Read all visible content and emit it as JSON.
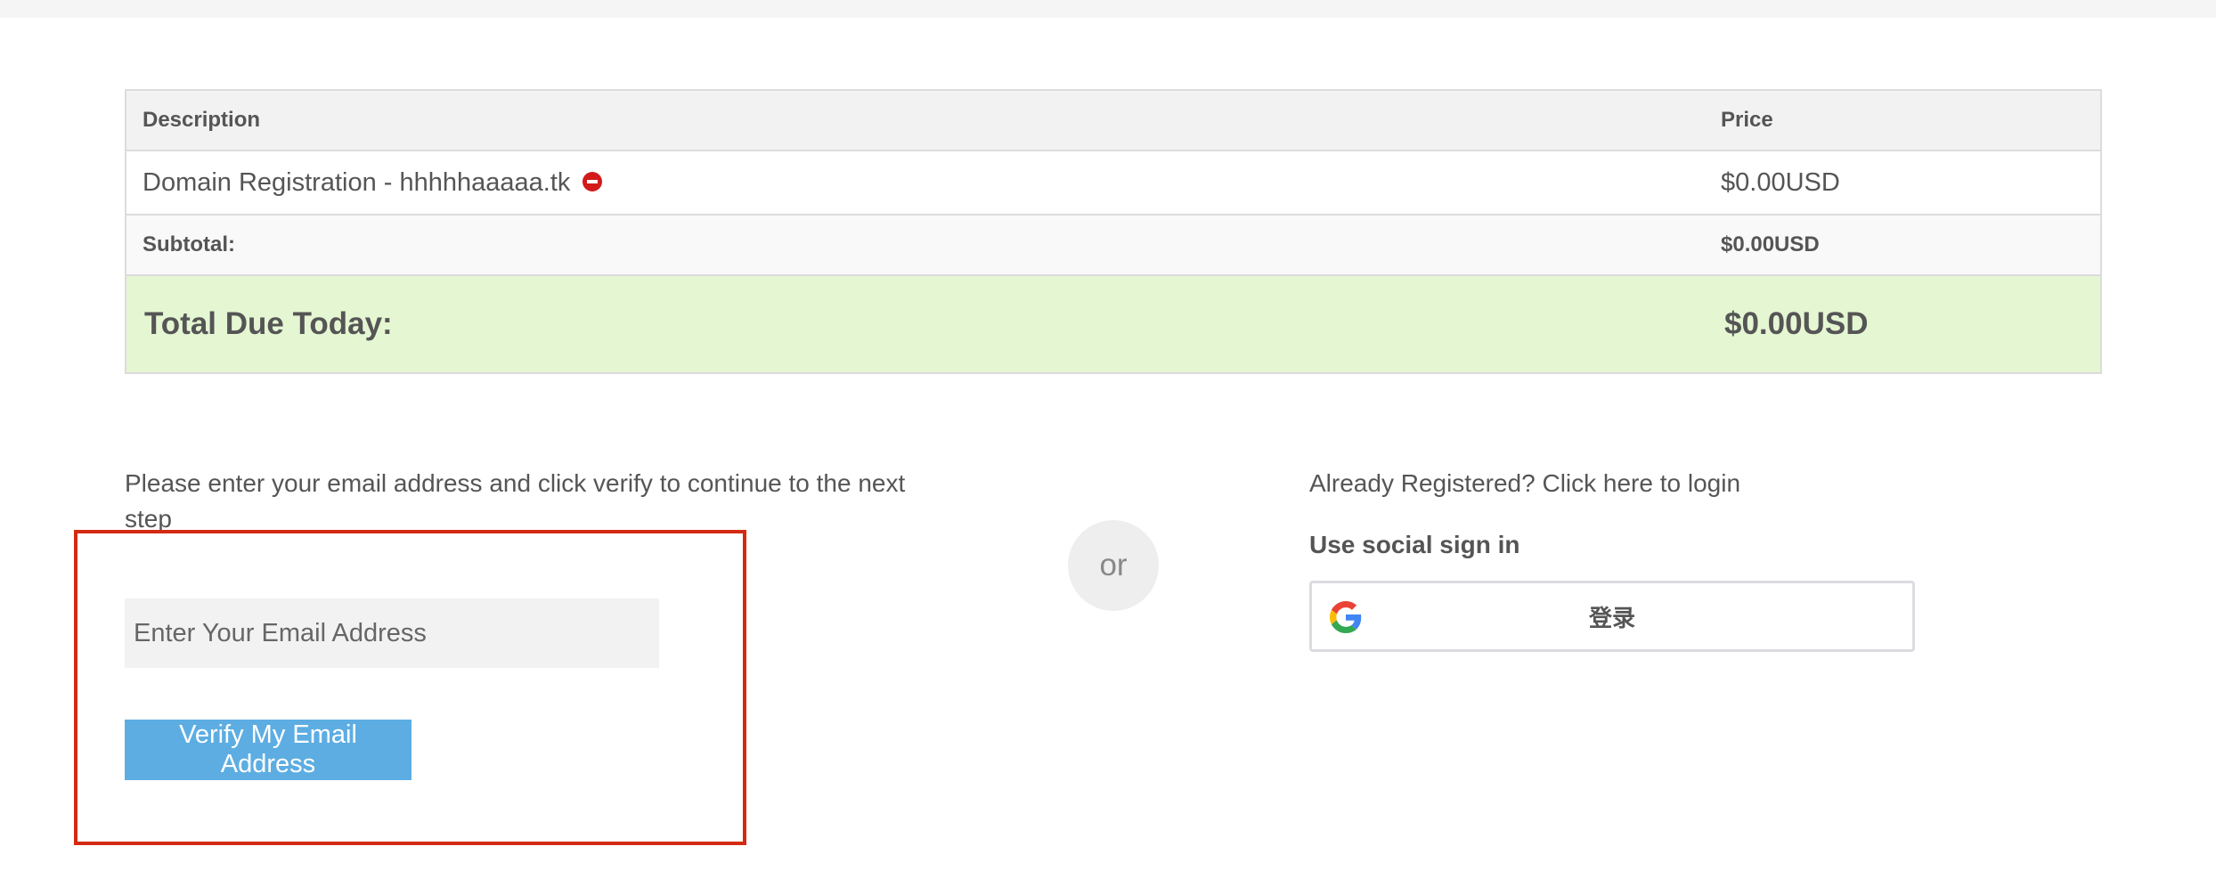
{
  "cart": {
    "headers": {
      "description": "Description",
      "price": "Price"
    },
    "item": {
      "description": "Domain Registration - hhhhhaaaaa.tk",
      "price": "$0.00USD",
      "remove_icon": "remove-circle-icon"
    },
    "subtotal": {
      "label": "Subtotal:",
      "value": "$0.00USD"
    },
    "total": {
      "label": "Total Due Today:",
      "value": "$0.00USD"
    }
  },
  "email_verify": {
    "instructions": "Please enter your email address and click verify to continue to the next step",
    "input_placeholder": "Enter Your Email Address",
    "input_value": "",
    "button_label": "Verify My Email Address"
  },
  "divider": {
    "label": "or"
  },
  "login": {
    "link_text": "Already Registered? Click here to login",
    "social_heading": "Use social sign in",
    "google_button_label": "登录",
    "google_icon": "google-g-icon"
  },
  "colors": {
    "total_row_bg": "#e5f6d3",
    "verify_button_bg": "#5dade2",
    "highlight_border": "#d42a12",
    "remove_icon": "#d21a1a"
  }
}
